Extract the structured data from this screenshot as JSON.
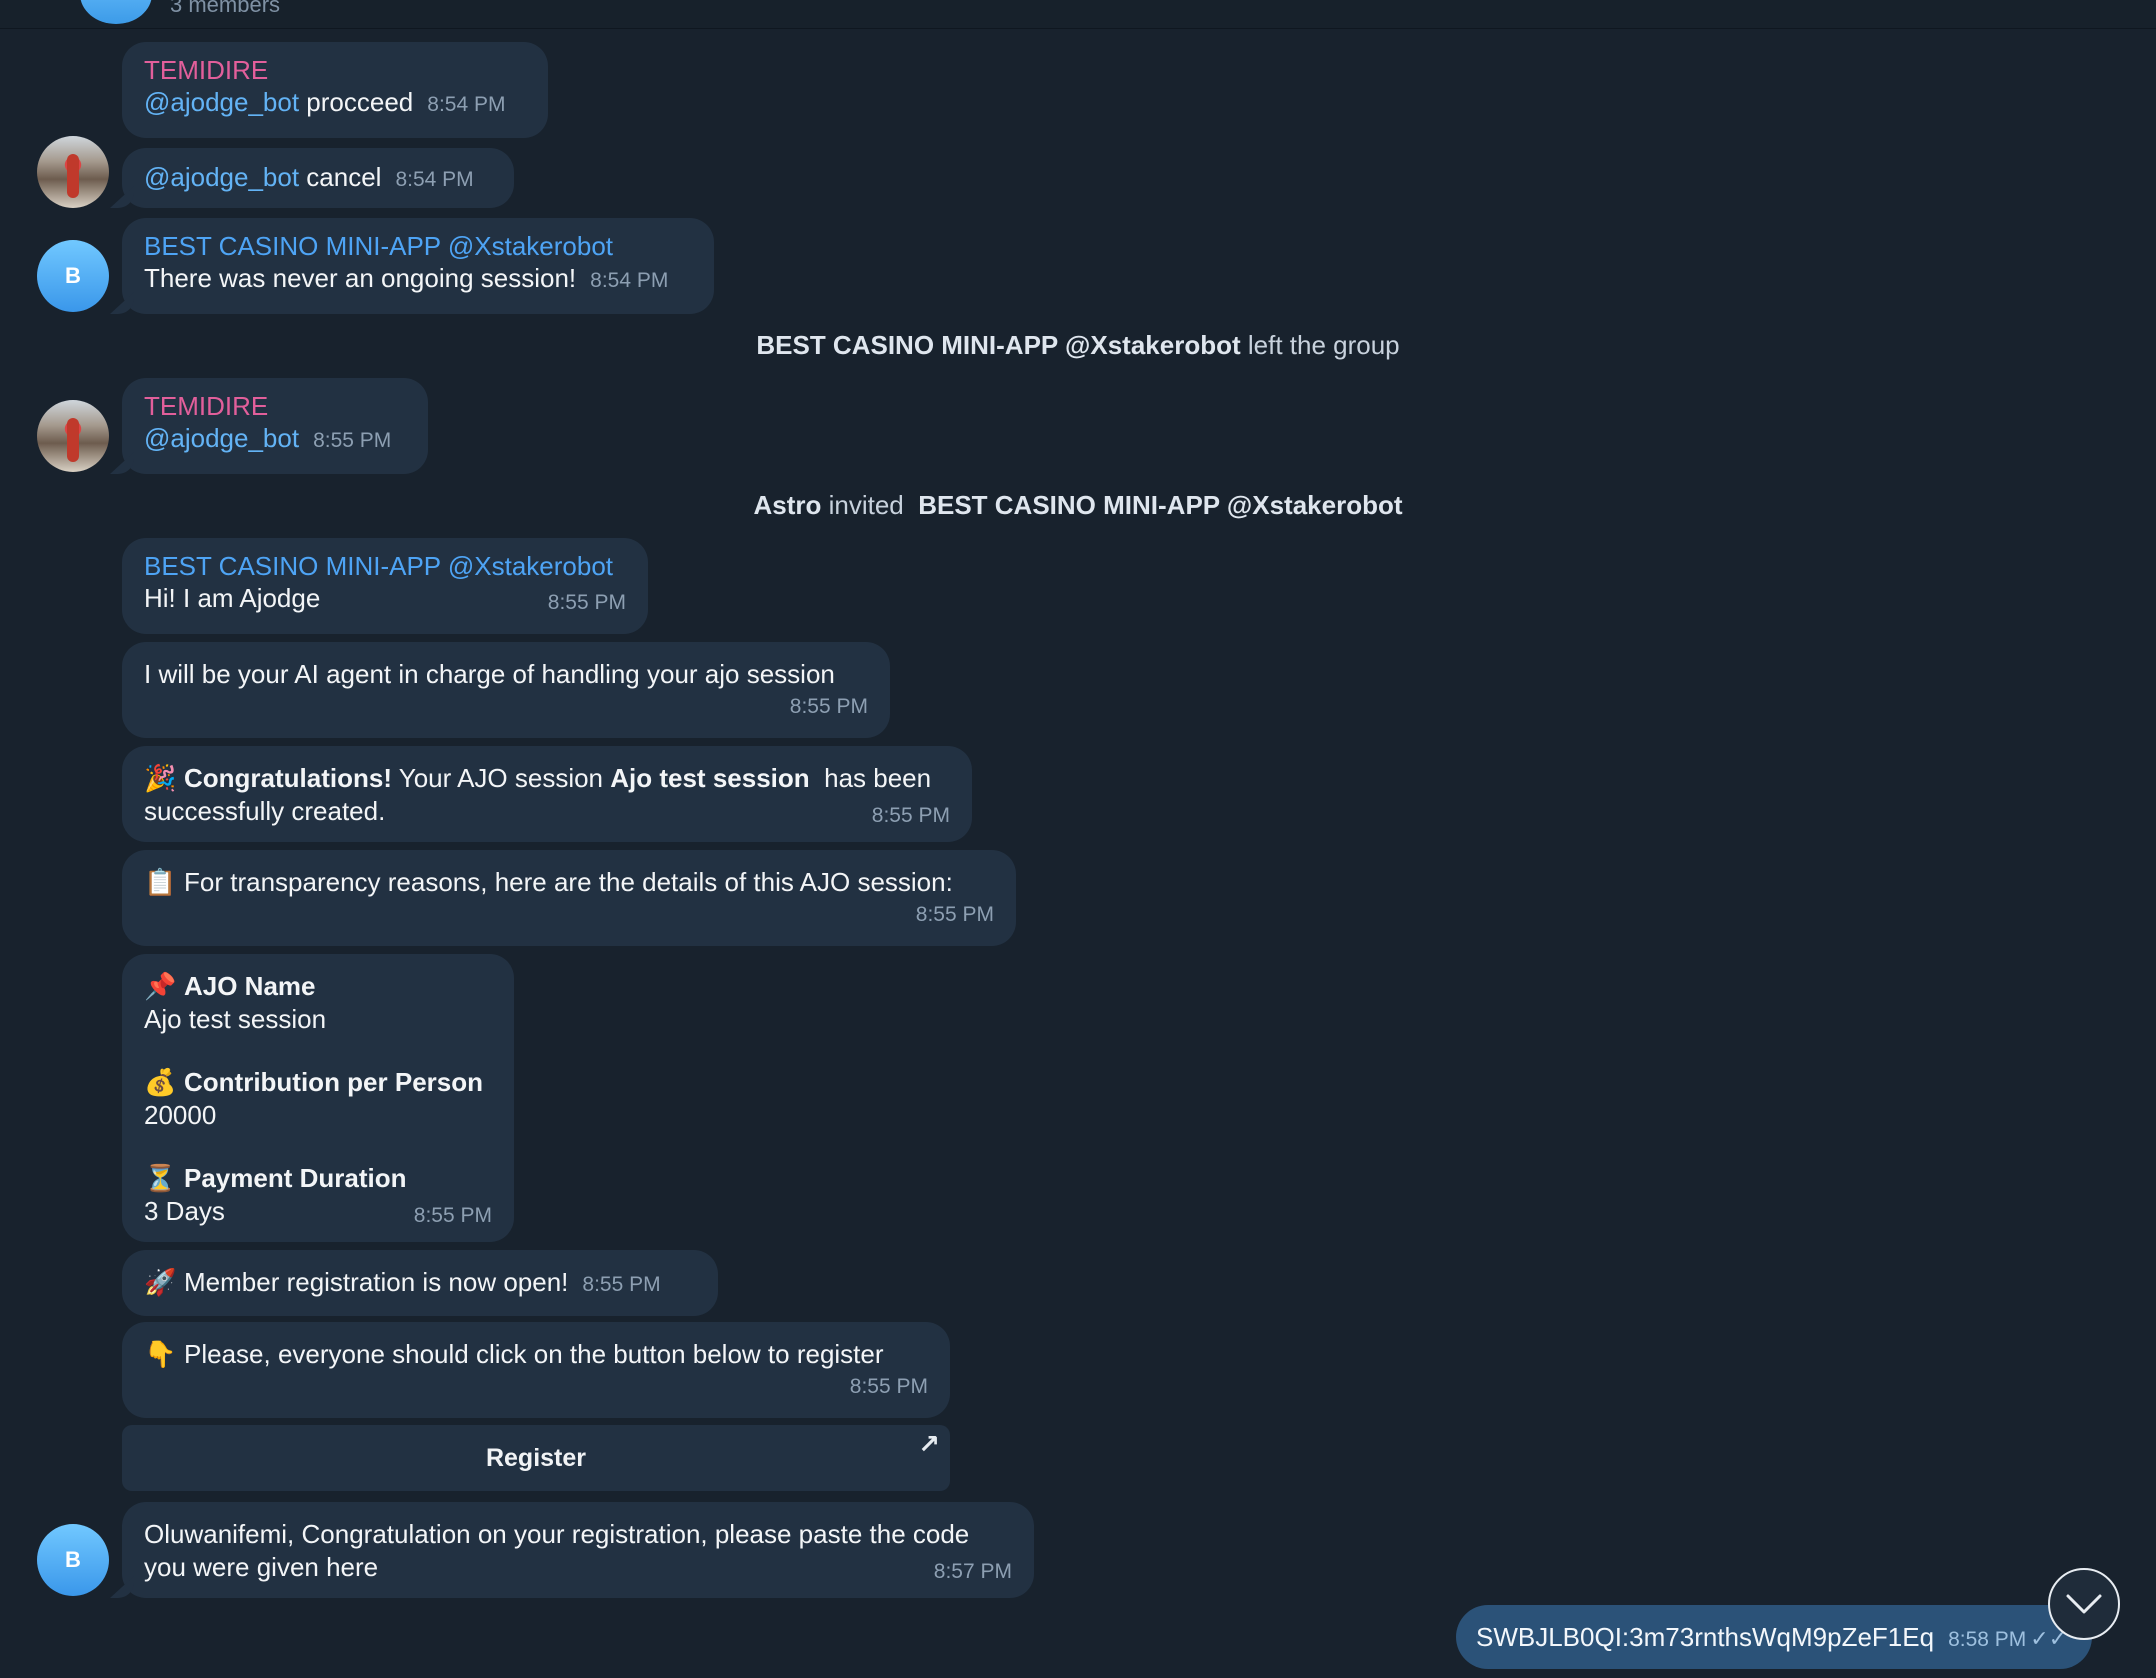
{
  "header": {
    "members": "3 members"
  },
  "messages": {
    "m1": {
      "sender": "TEMIDIRE",
      "mention": "@ajodge_bot",
      "text": " procceed",
      "time": "8:54 PM"
    },
    "m2": {
      "mention": "@ajodge_bot",
      "text": " cancel",
      "time": "8:54 PM"
    },
    "m3": {
      "sender": "BEST CASINO MINI-APP @Xstakerobot",
      "text": "There was never an ongoing session!",
      "time": "8:54 PM",
      "avatar_letter": "B"
    },
    "m4": {
      "sender": "TEMIDIRE",
      "mention": "@ajodge_bot",
      "time": "8:55 PM"
    },
    "m5": {
      "sender": "BEST CASINO MINI-APP @Xstakerobot",
      "text": "Hi! I am Ajodge",
      "time": "8:55 PM"
    },
    "m6": {
      "text": "I will be your AI agent in charge of handling your ajo session",
      "time": "8:55 PM"
    },
    "m7": {
      "emoji": "🎉",
      "bold1": "Congratulations!",
      "t1": " Your AJO session ",
      "bold2": "Ajo test session",
      "t2": "  has been successfully created.",
      "time": "8:55 PM"
    },
    "m8": {
      "emoji": "📋",
      "text": "For transparency reasons, here are the details of this AJO session:",
      "time": "8:55 PM"
    },
    "m9": {
      "name_emoji": "📌",
      "name_label": "AJO Name",
      "name_value": "Ajo test session",
      "contrib_emoji": "💰",
      "contrib_label": "Contribution per Person",
      "contrib_value": "20000",
      "duration_emoji": "⏳",
      "duration_label": "Payment Duration",
      "duration_value": "3 Days",
      "time": "8:55 PM"
    },
    "m10": {
      "emoji": "🚀",
      "text": "Member registration is now open!",
      "time": "8:55 PM"
    },
    "m11": {
      "emoji": "👇",
      "text": "Please, everyone should click on the button below to register",
      "time": "8:55 PM"
    },
    "m12": {
      "text": "Oluwanifemi, Congratulation on your registration, please paste the code you were given here",
      "time": "8:57 PM",
      "avatar_letter": "B"
    },
    "out": {
      "text": "SWBJLB0QI:3m73rnthsWqM9pZeF1Eq",
      "time": "8:58 PM",
      "status": "✓✓"
    }
  },
  "service": {
    "left_name": "BEST CASINO MINI-APP @Xstakerobot",
    "left_text": " left the group",
    "invite_actor": "Astro",
    "invite_text": " invited  ",
    "invite_name": "BEST CASINO MINI-APP @Xstakerobot"
  },
  "keyboard": {
    "register_label": "Register",
    "arrow": "↗"
  },
  "icons": {
    "scroll_down": "chevron-down-icon"
  }
}
